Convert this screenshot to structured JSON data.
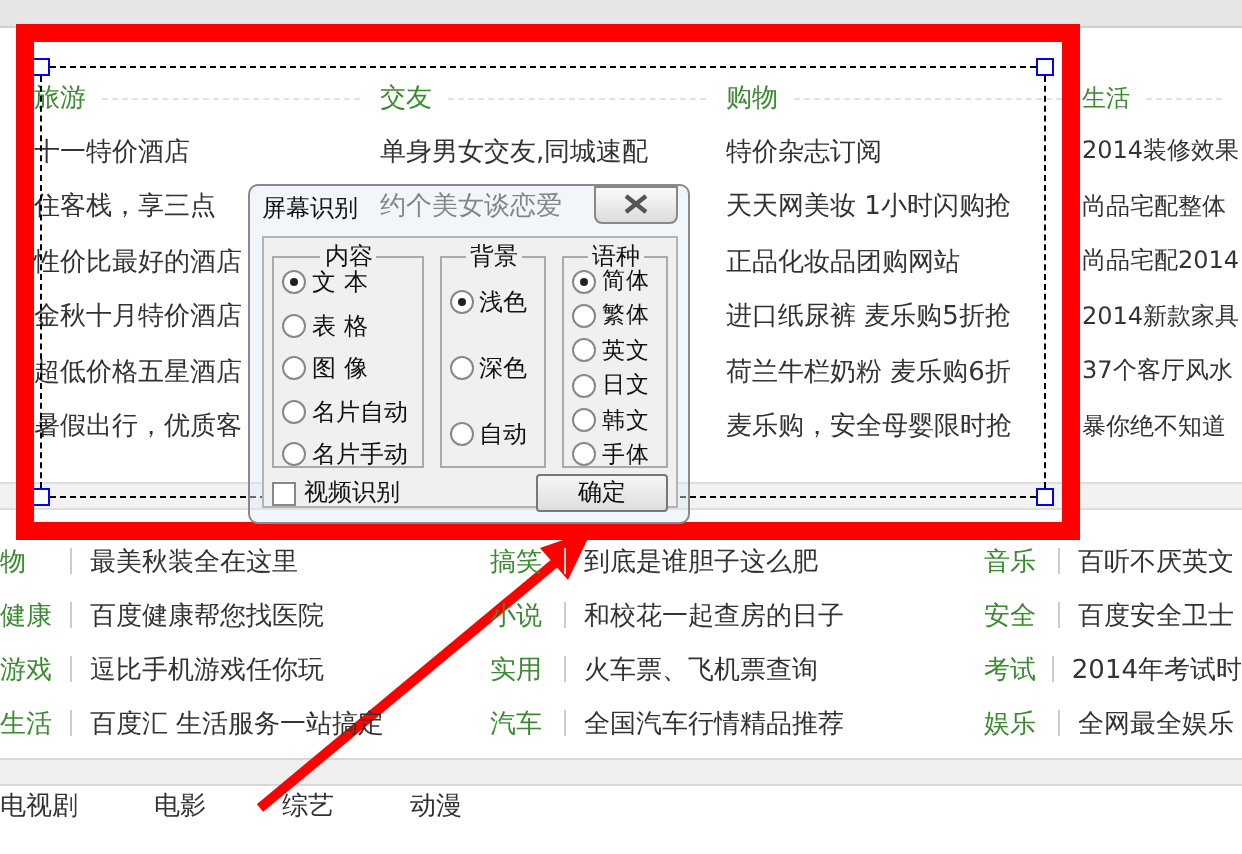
{
  "top_sections": [
    {
      "title": "旅游",
      "items": [
        "十一特价酒店",
        "住客栈，享三点",
        "性价比最好的酒店",
        "金秋十月特价酒店",
        "超低价格五星酒店",
        "暑假出行，优质客"
      ]
    },
    {
      "title": "交友",
      "items": [
        "单身男女交友,同城速配",
        "约个美女谈恋爱"
      ]
    },
    {
      "title": "购物",
      "items": [
        "特价杂志订阅",
        "天天网美妆 1小时闪购抢",
        "正品化妆品团购网站",
        "进口纸尿裤 麦乐购5折抢",
        "荷兰牛栏奶粉 麦乐购6折",
        "麦乐购，安全母婴限时抢"
      ]
    },
    {
      "title": "生活",
      "items": [
        "2014装修效果",
        "尚品宅配整体",
        "尚品宅配2014",
        "2014新款家具",
        "37个客厅风水",
        "暴你绝不知道"
      ]
    }
  ],
  "link_rows": [
    {
      "groups": [
        {
          "category": "物",
          "text": "最美秋装全在这里"
        },
        {
          "category": "搞笑",
          "text": "到底是谁胆子这么肥"
        },
        {
          "category": "音乐",
          "text": "百听不厌英文"
        }
      ]
    },
    {
      "groups": [
        {
          "category": "健康",
          "text": "百度健康帮您找医院"
        },
        {
          "category": "小说",
          "text": "和校花一起查房的日子"
        },
        {
          "category": "安全",
          "text": "百度安全卫士"
        }
      ]
    },
    {
      "groups": [
        {
          "category": "游戏",
          "text": "逗比手机游戏任你玩"
        },
        {
          "category": "实用",
          "text": "火车票、飞机票查询"
        },
        {
          "category": "考试",
          "text": "2014年考试时"
        }
      ]
    },
    {
      "groups": [
        {
          "category": "生活",
          "text": "百度汇 生活服务一站搞定"
        },
        {
          "category": "汽车",
          "text": "全国汽车行情精品推荐"
        },
        {
          "category": "娱乐",
          "text": "全网最全娱乐"
        }
      ]
    }
  ],
  "bottom_tabs": [
    "电视剧",
    "电影",
    "综艺",
    "动漫"
  ],
  "dialog": {
    "title": "屏幕识别",
    "groups": [
      {
        "title": "内容",
        "options": [
          {
            "label": "文 本",
            "selected": true
          },
          {
            "label": "表 格",
            "selected": false
          },
          {
            "label": "图 像",
            "selected": false
          },
          {
            "label": "名片自动",
            "selected": false
          },
          {
            "label": "名片手动",
            "selected": false
          }
        ]
      },
      {
        "title": "背景",
        "options": [
          {
            "label": "浅色",
            "selected": true
          },
          {
            "label": "深色",
            "selected": false
          },
          {
            "label": "自动",
            "selected": false
          }
        ]
      },
      {
        "title": "语种",
        "options": [
          {
            "label": "简体",
            "selected": true
          },
          {
            "label": "繁体",
            "selected": false
          },
          {
            "label": "英文",
            "selected": false
          },
          {
            "label": "日文",
            "selected": false
          },
          {
            "label": "韩文",
            "selected": false
          },
          {
            "label": "手体",
            "selected": false
          }
        ]
      }
    ],
    "checkbox": {
      "label": "视频识别",
      "checked": false
    },
    "button": "确定"
  }
}
